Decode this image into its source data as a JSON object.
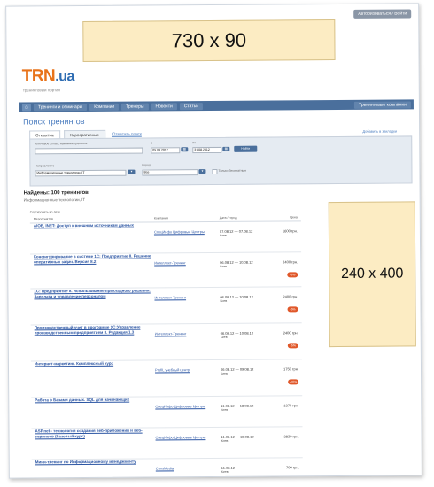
{
  "header": {
    "login_link": "Авторизоваться / Войти",
    "banner_top_text": "730 x 90",
    "logo_main": "TRN",
    "logo_suffix": ".ua",
    "tagline": "тренинговый портал"
  },
  "nav": {
    "items": [
      "Тренинги и семинары",
      "Компании",
      "Тренеры",
      "Новости",
      "Статьи"
    ],
    "right_item": "Тренинговые компании"
  },
  "search": {
    "title": "Поиск тренингов",
    "tabs": [
      "Открытые",
      "Корпоративные"
    ],
    "tab_link": "Отметить поиск",
    "right_link": "Добавить в закладки",
    "labels": {
      "keyword": "Ключевое слово, название тренинга",
      "date_from": "с",
      "date_to": "по",
      "direction": "Направление",
      "city": "Город",
      "online": "Только бесплатные"
    },
    "values": {
      "date_from": "05.08.2012",
      "date_to": "31.08.2012",
      "direction": "Информационные технологии, IT",
      "city": "Все"
    },
    "find_button": "Найти"
  },
  "results": {
    "title": "Найдены: 100 тренингов",
    "subtitle": "Информационные технологии, IT",
    "sort_label": "Сортировать по дате",
    "headers": [
      "Мероприятия",
      "Компания",
      "Дата / город",
      "Цена"
    ],
    "rows": [
      {
        "title": "AIOE, INET: Доступ к внешним источникам данных",
        "company": "СпецИнфо Цифровые Центры",
        "date": "07.08.12 — 07.08.12",
        "city": "Киев",
        "price": "1600 грн.",
        "badge": ""
      },
      {
        "title": "Конфигурирование в системе 1С: Предприятие 8. Решение оперативных задач. Версия 8.2",
        "company": "Интеллект-Тренинг",
        "date": "06.08.12 — 10.08.12",
        "city": "Киев",
        "price": "2400 грн.",
        "badge": "-5%"
      },
      {
        "title": "1С: Предприятие 8. Использование прикладного решения. Зарплата и управление персоналом",
        "company": "Интеллект-Тренинг",
        "date": "06.08.12 — 10.08.12",
        "city": "Киев",
        "price": "2400 грн.",
        "badge": "-5%"
      },
      {
        "title": "Производственный учет в программе 1С:Управление производственным предприятием 8. Редакция 1.3",
        "company": "Интеллект-Тренинг",
        "date": "06.08.12 — 10.08.12",
        "city": "Киев",
        "price": "2400 грн.",
        "badge": "-5%"
      },
      {
        "title": "Интернет-маркетинг. Комплексный курс",
        "company": "ProfiL учебный центр",
        "date": "06.08.12 — 09.08.12",
        "city": "Киев",
        "price": "1750 грн.",
        "badge": "-10%"
      },
      {
        "title": "Работа в Базами данных. SQL для начинающих",
        "company": "СпецИнфо Цифровые Центры",
        "date": "11.08.12 — 18.08.12",
        "city": "Киев",
        "price": "1370 грн.",
        "badge": ""
      },
      {
        "title": "ASP.net - технология создания веб-приложений и веб-сервисов (базовый курс)",
        "company": "СпецИнфо Цифровые Центры",
        "date": "11.08.12 — 18.08.12",
        "city": "Киев",
        "price": "3820 грн.",
        "badge": ""
      },
      {
        "title": "Мини-тренинг по Информационному менеджменту",
        "company": "ConsMedia",
        "date": "11.08.12",
        "city": "Киев",
        "price": "700 грн.",
        "badge": ""
      }
    ]
  },
  "sidebar": {
    "banner_text": "240 x 400"
  }
}
